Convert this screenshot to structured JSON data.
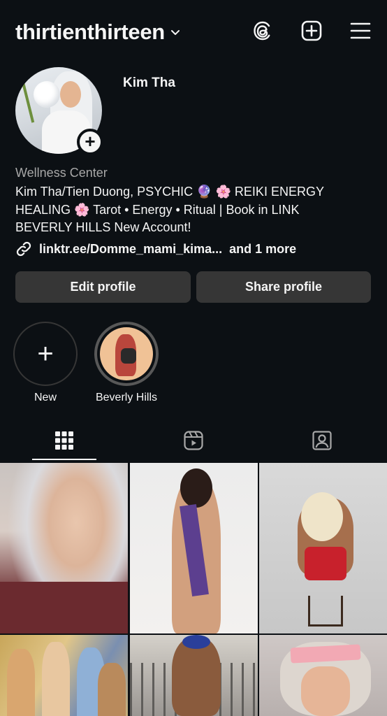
{
  "header": {
    "username": "thirtienthirteen",
    "icons": [
      "chevron-down-icon",
      "threads-icon",
      "create-post-icon",
      "menu-icon"
    ]
  },
  "profile": {
    "display_name": "Kim Tha",
    "category": "Wellness Center",
    "bio_line1": "Kim Tha/Tien Duong, PSYCHIC 🔮 🌸 REIKI ENERGY",
    "bio_line2": "HEALING 🌸 Tarot • Energy • Ritual | Book in LINK",
    "bio_line3": "BEVERLY HILLS New Account!",
    "link": "linktr.ee/Domme_mami_kima...",
    "link_more": "and 1 more"
  },
  "buttons": {
    "edit": "Edit profile",
    "share": "Share profile"
  },
  "highlights": [
    {
      "label": "New"
    },
    {
      "label": "Beverly Hills"
    }
  ],
  "tabs": [
    "posts-grid-icon",
    "reels-icon",
    "tagged-icon"
  ],
  "colors": {
    "background": "#0c1014",
    "button": "#363636",
    "secondary_text": "#a8a8a8",
    "primary_text": "#f5f5f5"
  }
}
